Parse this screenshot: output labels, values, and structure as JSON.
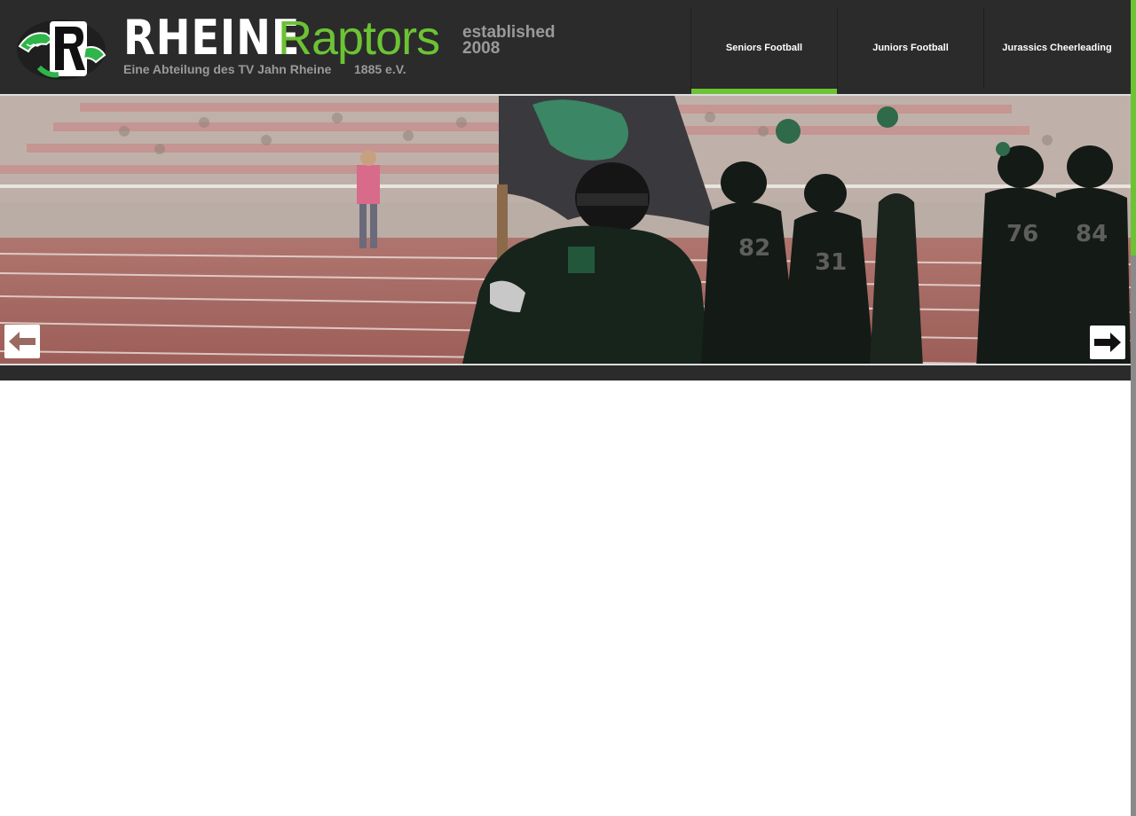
{
  "site": {
    "brand_main": "RHEINE",
    "brand_accent": "Raptors",
    "established_line1": "established",
    "established_line2": "2008",
    "subtitle": "Eine Abteilung des TV Jahn Rheine",
    "founded": "1885 e.V."
  },
  "nav": {
    "items": [
      {
        "label": "Seniors Football",
        "active": true
      },
      {
        "label": "Juniors Football",
        "active": false
      },
      {
        "label": "Jurassics Cheerleading",
        "active": false
      }
    ]
  },
  "slider": {
    "prev_icon": "arrow-left-icon",
    "next_icon": "arrow-right-icon"
  },
  "colors": {
    "header_bg": "#2b2b2b",
    "accent_green": "#6cc334",
    "muted_gray": "#9a9a9a"
  }
}
